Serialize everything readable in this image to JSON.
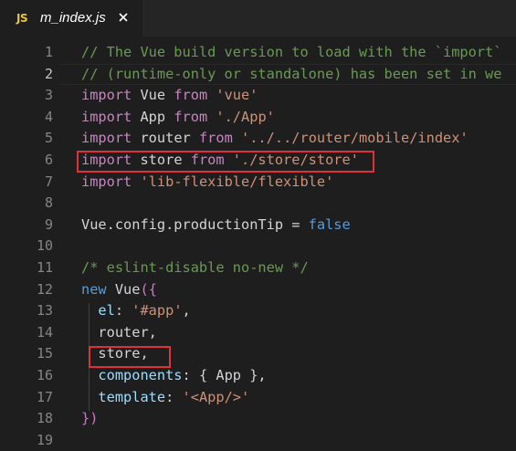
{
  "tab": {
    "icon_label": "JS",
    "title": "m_index.js",
    "close_icon": "close-icon"
  },
  "editor": {
    "active_line": 2,
    "lines": [
      {
        "n": "1",
        "tokens": [
          [
            "com",
            "// The Vue build version to load with the `import`"
          ]
        ]
      },
      {
        "n": "2",
        "tokens": [
          [
            "com",
            "// (runtime-only or standalone) has been set in we"
          ]
        ]
      },
      {
        "n": "3",
        "tokens": [
          [
            "kw2",
            "import"
          ],
          [
            "id",
            " Vue "
          ],
          [
            "kw2",
            "from"
          ],
          [
            "id",
            " "
          ],
          [
            "str",
            "'vue'"
          ]
        ]
      },
      {
        "n": "4",
        "tokens": [
          [
            "kw2",
            "import"
          ],
          [
            "id",
            " App "
          ],
          [
            "kw2",
            "from"
          ],
          [
            "id",
            " "
          ],
          [
            "str",
            "'./App'"
          ]
        ]
      },
      {
        "n": "5",
        "tokens": [
          [
            "kw2",
            "import"
          ],
          [
            "id",
            " router "
          ],
          [
            "kw2",
            "from"
          ],
          [
            "id",
            " "
          ],
          [
            "str",
            "'../../router/mobile/index'"
          ]
        ]
      },
      {
        "n": "6",
        "tokens": [
          [
            "kw2",
            "import"
          ],
          [
            "id",
            " store "
          ],
          [
            "kw2",
            "from"
          ],
          [
            "id",
            " "
          ],
          [
            "str",
            "'./store/store'"
          ]
        ]
      },
      {
        "n": "7",
        "tokens": [
          [
            "kw2",
            "import"
          ],
          [
            "id",
            " "
          ],
          [
            "str",
            "'lib-flexible/flexible'"
          ]
        ]
      },
      {
        "n": "8",
        "tokens": []
      },
      {
        "n": "9",
        "tokens": [
          [
            "id",
            "Vue.config.productionTip = "
          ],
          [
            "kw",
            "false"
          ]
        ]
      },
      {
        "n": "10",
        "tokens": []
      },
      {
        "n": "11",
        "tokens": [
          [
            "com",
            "/* eslint-disable no-new */"
          ]
        ]
      },
      {
        "n": "12",
        "tokens": [
          [
            "kw",
            "new"
          ],
          [
            "id",
            " Vue"
          ],
          [
            "paren",
            "({"
          ]
        ]
      },
      {
        "n": "13",
        "tokens": [
          [
            "id",
            "  "
          ],
          [
            "var",
            "el"
          ],
          [
            "id",
            ": "
          ],
          [
            "str",
            "'#app'"
          ],
          [
            "id",
            ","
          ]
        ]
      },
      {
        "n": "14",
        "tokens": [
          [
            "id",
            "  router,"
          ]
        ]
      },
      {
        "n": "15",
        "tokens": [
          [
            "id",
            "  store,"
          ]
        ]
      },
      {
        "n": "16",
        "tokens": [
          [
            "id",
            "  "
          ],
          [
            "var",
            "components"
          ],
          [
            "id",
            ": { App },"
          ]
        ]
      },
      {
        "n": "17",
        "tokens": [
          [
            "id",
            "  "
          ],
          [
            "var",
            "template"
          ],
          [
            "id",
            ": "
          ],
          [
            "str",
            "'<App/>'"
          ]
        ]
      },
      {
        "n": "18",
        "tokens": [
          [
            "paren",
            "})"
          ]
        ]
      },
      {
        "n": "19",
        "tokens": []
      }
    ]
  },
  "highlights": [
    {
      "label": "import-store-line",
      "line": "6"
    },
    {
      "label": "store-property",
      "line": "15"
    }
  ],
  "colors": {
    "background": "#1e1e1e",
    "keyword_purple": "#c586c0",
    "keyword_blue": "#569cd6",
    "string": "#ce9178",
    "comment": "#6a9955",
    "highlight_box": "#e0303a"
  }
}
